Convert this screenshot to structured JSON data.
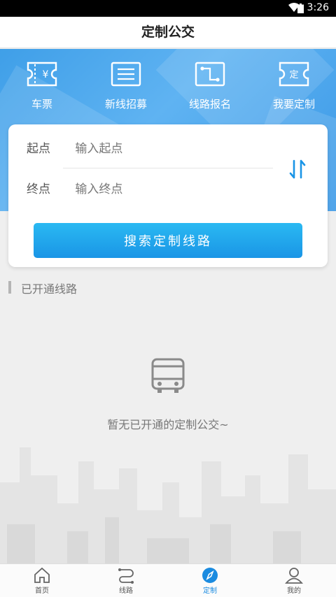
{
  "status": {
    "time": "3:26"
  },
  "header": {
    "title": "定制公交"
  },
  "quick_actions": [
    {
      "label": "车票",
      "icon": "ticket-icon"
    },
    {
      "label": "新线招募",
      "icon": "list-icon"
    },
    {
      "label": "线路报名",
      "icon": "route-icon"
    },
    {
      "label": "我要定制",
      "icon": "custom-ticket-icon"
    }
  ],
  "search": {
    "start_label": "起点",
    "start_placeholder": "输入起点",
    "end_label": "终点",
    "end_placeholder": "输入终点",
    "button_label": "搜索定制线路"
  },
  "opened": {
    "section_title": "已开通线路",
    "empty_text": "暂无已开通的定制公交~"
  },
  "tabs": [
    {
      "label": "首页",
      "icon": "home-icon"
    },
    {
      "label": "线路",
      "icon": "route-icon"
    },
    {
      "label": "定制",
      "icon": "compass-icon",
      "active": true
    },
    {
      "label": "我的",
      "icon": "user-icon"
    }
  ],
  "colors": {
    "primary": "#1a95e6",
    "hero": "#4aa7ee",
    "background": "#efefef"
  }
}
